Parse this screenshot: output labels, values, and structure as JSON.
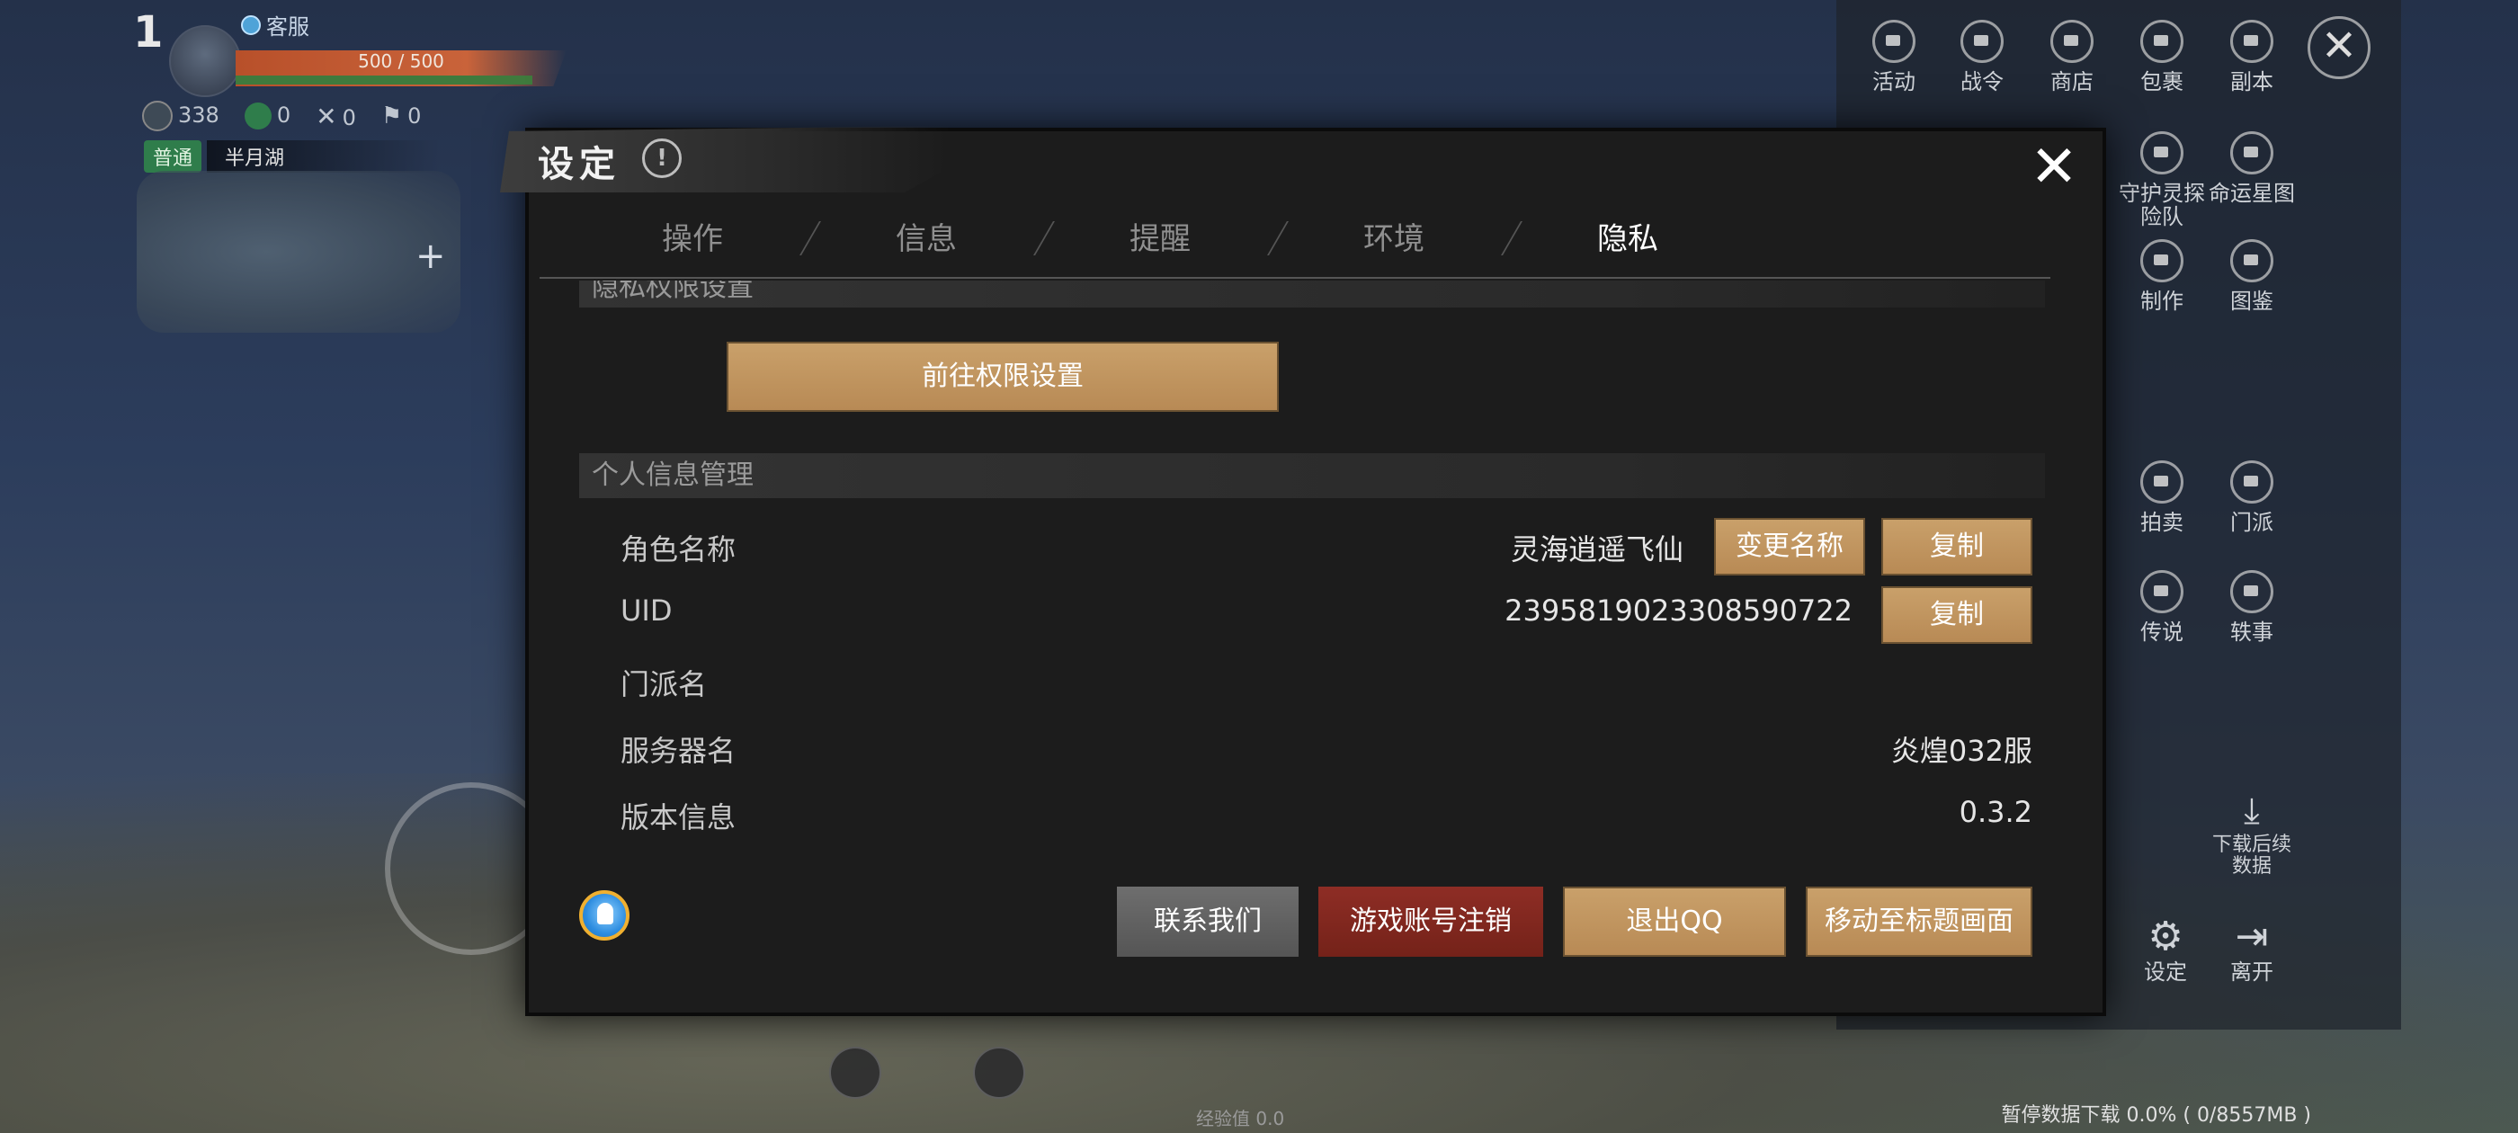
{
  "hud": {
    "level": "1",
    "service_label": "客服",
    "hp_text": "500 / 500",
    "stat_power": "338",
    "stat_green": "0",
    "stat_cross": "0",
    "stat_flag": "0",
    "mode_tag": "普通",
    "location": "半月湖",
    "exp_text": "经验值 0.0",
    "download_status": "暂停数据下载 0.0% ( 0/8557MB )"
  },
  "right_menu": {
    "items": [
      {
        "label": "活动"
      },
      {
        "label": "战令"
      },
      {
        "label": "商店"
      },
      {
        "label": "包裹"
      },
      {
        "label": "副本"
      },
      {
        "label": "守护灵探险队"
      },
      {
        "label": "命运星图"
      },
      {
        "label": "制作"
      },
      {
        "label": "图鉴"
      },
      {
        "label": "拍卖"
      },
      {
        "label": "门派"
      },
      {
        "label": "传说"
      },
      {
        "label": "轶事"
      },
      {
        "label": "下载后续数据"
      },
      {
        "label": "设定"
      },
      {
        "label": "离开"
      }
    ]
  },
  "modal": {
    "title": "设定",
    "info_icon": "!",
    "close_icon": "✕",
    "tabs": [
      {
        "label": "操作"
      },
      {
        "label": "信息"
      },
      {
        "label": "提醒"
      },
      {
        "label": "环境"
      },
      {
        "label": "隐私",
        "active": true
      }
    ],
    "privacy_section_title": "隐私权限设置",
    "permission_button": "前往权限设置",
    "info_section_title": "个人信息管理",
    "rows": {
      "character_name": {
        "label": "角色名称",
        "value": "灵海逍遥飞仙",
        "rename_button": "变更名称",
        "copy_button": "复制"
      },
      "uid": {
        "label": "UID",
        "value": "2395819023308590722",
        "copy_button": "复制"
      },
      "sect": {
        "label": "门派名",
        "value": ""
      },
      "server": {
        "label": "服务器名",
        "value": "炎煌032服"
      },
      "version": {
        "label": "版本信息",
        "value": "0.3.2"
      }
    },
    "footer_buttons": {
      "contact": "联系我们",
      "delete_account": "游戏账号注销",
      "logout_qq": "退出QQ",
      "to_title": "移动至标题画面"
    }
  },
  "colors": {
    "gold_button": "#c9a06a",
    "red_button": "#8e2d25",
    "grey_button": "#6e6e6e",
    "modal_bg": "#1c1c1c"
  }
}
